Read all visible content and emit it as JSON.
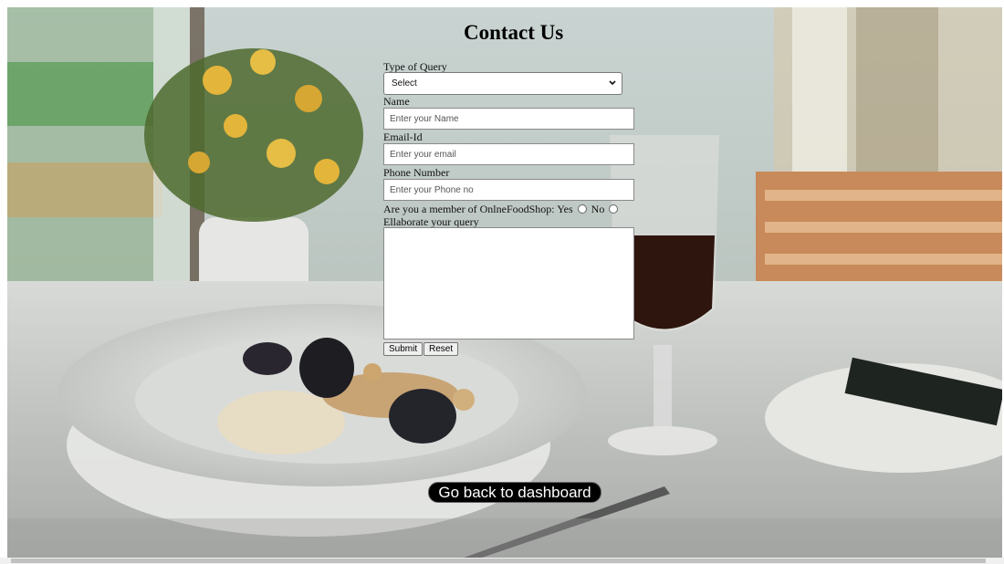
{
  "page": {
    "title": "Contact Us"
  },
  "form": {
    "query_type_label": "Type of Query",
    "query_type_selected": "Select",
    "name_label": "Name",
    "name_placeholder": "Enter your Name",
    "email_label": "Email-Id",
    "email_placeholder": "Enter your email",
    "phone_label": "Phone Number",
    "phone_placeholder": "Enter your Phone no",
    "member_question": "Are you a member of OnlneFoodShop:",
    "member_yes": "Yes",
    "member_no": "No",
    "query_label": "Ellaborate your query",
    "submit_label": "Submit",
    "reset_label": "Reset"
  },
  "nav": {
    "dashboard_label": "Go back to dashboard"
  },
  "colors": {
    "button_bg": "#000000",
    "button_text": "#ffffff"
  }
}
